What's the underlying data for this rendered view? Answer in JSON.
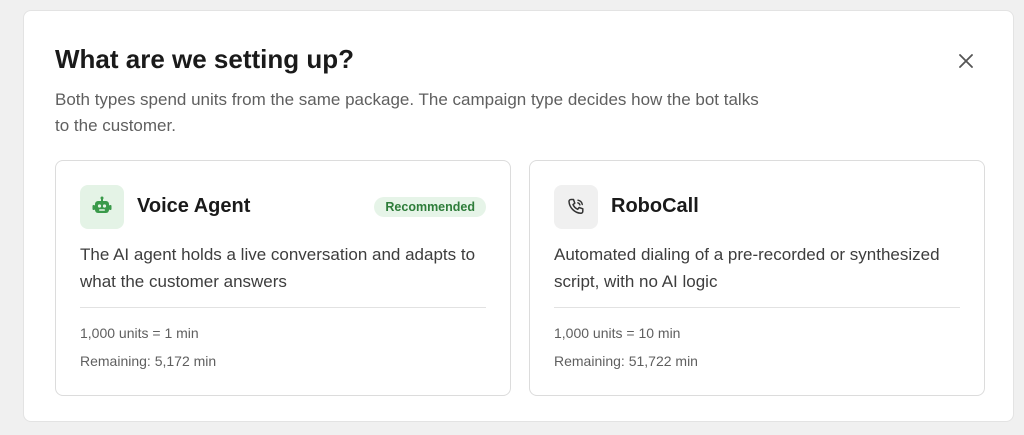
{
  "modal": {
    "title": "What are we setting up?",
    "subtitle": "Both types spend units from the same package. The campaign type decides how the bot talks to the customer.",
    "close_icon": "close-icon"
  },
  "options": [
    {
      "icon": "robot-icon",
      "title": "Voice Agent",
      "badge": "Recommended",
      "description": "The AI agent holds a live conversation and adapts to what the customer answers",
      "rate": "1,000 units = 1 min",
      "remaining": "Remaining: 5,172 min"
    },
    {
      "icon": "phone-icon",
      "title": "RoboCall",
      "description": "Automated dialing of a pre-recorded or synthesized script, with no AI logic",
      "rate": "1,000 units = 10 min",
      "remaining": "Remaining: 51,722 min"
    }
  ],
  "colors": {
    "accent_green": "#3a9a4a",
    "badge_bg": "#e6f4e8",
    "badge_text": "#2e7d3a"
  }
}
